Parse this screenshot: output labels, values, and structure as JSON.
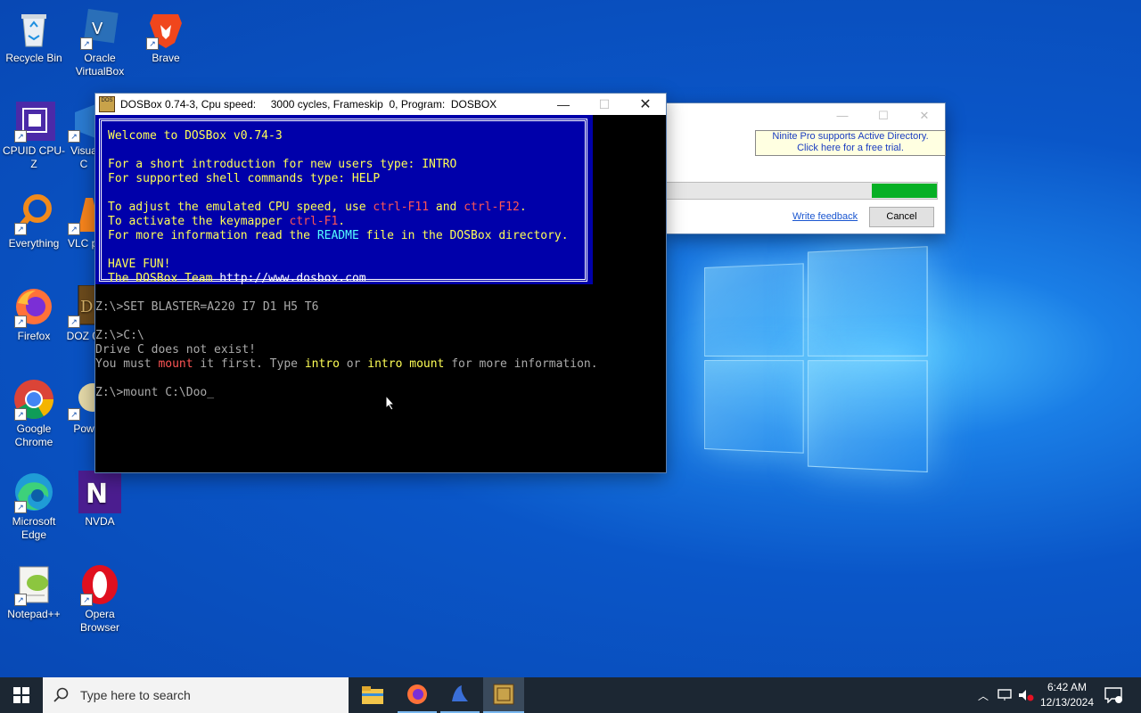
{
  "desktop_icons": [
    {
      "label": "Recycle Bin",
      "icon": "recycle-bin-icon"
    },
    {
      "label": "Oracle VirtualBox",
      "icon": "virtualbox-icon"
    },
    {
      "label": "Brave",
      "icon": "brave-icon"
    },
    {
      "label": "CPUID CPU-Z",
      "icon": "cpuz-icon"
    },
    {
      "label": "Visua C",
      "icon": "visual-studio-icon"
    },
    {
      "label": "Everything",
      "icon": "everything-search-icon"
    },
    {
      "label": "VLC pl",
      "icon": "vlc-icon"
    },
    {
      "label": "Firefox",
      "icon": "firefox-icon"
    },
    {
      "label": "DOZ 0.",
      "icon": "doom-icon"
    },
    {
      "label": "Google Chrome",
      "icon": "chrome-icon"
    },
    {
      "label": "Pow",
      "icon": "powershell-icon"
    },
    {
      "label": "Microsoft Edge",
      "icon": "edge-icon"
    },
    {
      "label": "NVDA",
      "icon": "nvda-icon"
    },
    {
      "label": "Notepad++",
      "icon": "notepadpp-icon"
    },
    {
      "label": "Opera Browser",
      "icon": "opera-icon"
    }
  ],
  "ninite": {
    "promo_line1": "Ninite Pro supports Active Directory.",
    "promo_line2": "Click here for a free trial.",
    "feedback_link": "Write feedback",
    "cancel_label": "Cancel",
    "progress": 0.25,
    "progress_color": "#06b025"
  },
  "dosbox": {
    "title": "DOSBox 0.74-3, Cpu speed:     3000 cycles, Frameskip  0, Program:  DOSBOX",
    "welcome": {
      "heading": "Welcome to DOSBox v0.74-3",
      "intro_line_a": "For a short introduction for new users type: INTRO",
      "intro_line_b": "For supported shell commands type: HELP",
      "cpu_pre": "To adjust the emulated CPU speed, use ",
      "cpu_key1": "ctrl-F11",
      "cpu_and": " and ",
      "cpu_key2": "ctrl-F12",
      "cpu_end": ".",
      "keymap_pre": "To activate the keymapper ",
      "keymap_key": "ctrl-F1",
      "keymap_end": ".",
      "readme_pre": "For more information read the ",
      "readme_word": "README",
      "readme_post": " file in the DOSBox directory.",
      "fun": "HAVE FUN!",
      "team_pre": "The DOSBox Team ",
      "team_url": "http://www.dosbox.com"
    },
    "lines": {
      "set_blaster": "Z:\\>SET BLASTER=A220 I7 D1 H5 T6",
      "cmd_c": "Z:\\>C:\\",
      "drive_err": "Drive C does not exist!",
      "must_pre": "You must ",
      "must_mount": "mount",
      "must_mid": " it first. Type ",
      "must_intro": "intro",
      "must_or": " or ",
      "must_intro_mount": "intro mount",
      "must_post": " for more information.",
      "current_cmd": "Z:\\>mount C:\\Doo_"
    }
  },
  "taskbar": {
    "search_placeholder": "Type here to search",
    "time": "6:42 AM",
    "date": "12/13/2024"
  }
}
